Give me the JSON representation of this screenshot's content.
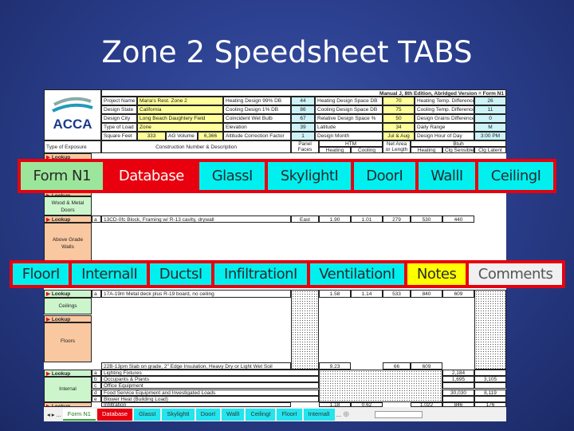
{
  "slide": {
    "title": "Zone 2 Speedsheet TABS"
  },
  "sheet": {
    "banner": "Manual J, 8th Edition, Abridged Version = Form N1",
    "logo": "ACCA",
    "project": [
      [
        "Project Name",
        "Maria's Rest. Zone 2"
      ],
      [
        "Design State",
        "California"
      ],
      [
        "Design City",
        "Long Beach Daughtery Field"
      ],
      [
        "Type of Load",
        "Zone"
      ]
    ],
    "square_feet": {
      "label": "Square Feet",
      "value": "333",
      "ag_label": "AG Volume",
      "ag_value": "6,366"
    },
    "design": [
      [
        "Heating Design 99% DB",
        "44"
      ],
      [
        "Cooling Design 1% DB",
        "86"
      ],
      [
        "Coincident Wet Bulb",
        "67"
      ],
      [
        "Elevation",
        "39"
      ],
      [
        "Altitude Correction Factor",
        "1"
      ]
    ],
    "space": [
      [
        "Heating Design Space DB",
        "70"
      ],
      [
        "Cooling Design Space DB",
        "75"
      ],
      [
        "Relative Design Space %",
        "50"
      ],
      [
        "Latitude",
        "34"
      ],
      [
        "Design Month",
        "Jul & Aug"
      ]
    ],
    "diff": [
      [
        "Heating Temp. Difference",
        "26"
      ],
      [
        "Cooling Temp. Difference",
        "11"
      ],
      [
        "Design Grains Difference",
        "0"
      ],
      [
        "Daily Range",
        "M"
      ],
      [
        "Design Hour of Day",
        "3:00 PM"
      ]
    ],
    "headers": {
      "exposure": "Type of Exposure",
      "construction": "Construction Number & Description",
      "panel": "Panel Faces",
      "htm": "HTM",
      "heating": "Heating",
      "cooling": "Cooling",
      "netarea": "Net Area or Length",
      "btuh": "Btuh",
      "btu_heating": "Heating",
      "clg_sensible": "Clg Sensible",
      "clg_latent": "Clg Latent"
    },
    "lookup": "Lookup",
    "groups": {
      "doors": "Wood & Metal Doors",
      "walls": "Above Grade Walls",
      "ceilings": "Ceilings",
      "floors": "Floors",
      "internal": "Internal"
    },
    "wall_row": {
      "letter": "a",
      "desc": "13CD-0fc Block, Framing w/ R-13 cavity, drywall",
      "panel": "East",
      "heating": "1.90",
      "cooling": "1.01",
      "area": "279",
      "btu_h": "530",
      "btu_s": "440"
    },
    "ceiling_row": {
      "letter": "a",
      "desc": "17A-19m Metal deck plus R-19 board, no ceiling",
      "heating": "1.58",
      "cooling": "1.14",
      "area": "533",
      "btu_h": "840",
      "btu_s": "609"
    },
    "floor_row": {
      "letter": "f",
      "desc": "22B-13pm Slab on grade, 2\" Edge Insulation, Heavy Dry or Light Wet Soil",
      "heating": "9.23",
      "area": "66",
      "btu_h": "609"
    },
    "internal": [
      {
        "letter": "a",
        "desc": "Lighting Fixtures",
        "sens": "2,184",
        "lat": ""
      },
      {
        "letter": "b",
        "desc": "Occupants & Plants",
        "sens": "1,695",
        "lat": "3,105"
      },
      {
        "letter": "c",
        "desc": "Office Equipment",
        "sens": "",
        "lat": ""
      },
      {
        "letter": "d",
        "desc": "Food Service Equipment and Investigated Loads",
        "sens": "30,030",
        "lat": "8,119"
      },
      {
        "letter": "e",
        "desc": "Blower Heat (Building Load)",
        "sens": "",
        "lat": ""
      }
    ],
    "infiltration": {
      "desc": "Infiltration",
      "heating": "1.18",
      "cooling": "0.62",
      "btu_h": "1,022",
      "btu_s": "846",
      "lat": "176"
    },
    "bottom_tabs": [
      "Form N1",
      "Database",
      "GlassI",
      "SkylightI",
      "DoorI",
      "WallI",
      "CeilingI",
      "FloorI",
      "InternalI"
    ],
    "nav": [
      "◂",
      "▸",
      "...",
      "...",
      "⊕"
    ]
  },
  "callouts": {
    "row1": [
      {
        "label": "Form N1",
        "color": "#9be69b"
      },
      {
        "label": "Database",
        "color": "#e8000e"
      },
      {
        "label": "GlassI",
        "color": "#00f0f0"
      },
      {
        "label": "SkylightI",
        "color": "#00f0f0"
      },
      {
        "label": "DoorI",
        "color": "#00f0f0"
      },
      {
        "label": "WallI",
        "color": "#00f0f0"
      },
      {
        "label": "CeilingI",
        "color": "#00f0f0"
      }
    ],
    "row2": [
      {
        "label": "FloorI",
        "color": "#00f0f0"
      },
      {
        "label": "InternalI",
        "color": "#00f0f0"
      },
      {
        "label": "DuctsI",
        "color": "#00f0f0"
      },
      {
        "label": "InfiltrationI",
        "color": "#00f0f0"
      },
      {
        "label": "VentilationI",
        "color": "#00f0f0"
      },
      {
        "label": "Notes",
        "color": "#ffff00"
      },
      {
        "label": "Comments",
        "color": "#f0f0f0"
      }
    ]
  }
}
